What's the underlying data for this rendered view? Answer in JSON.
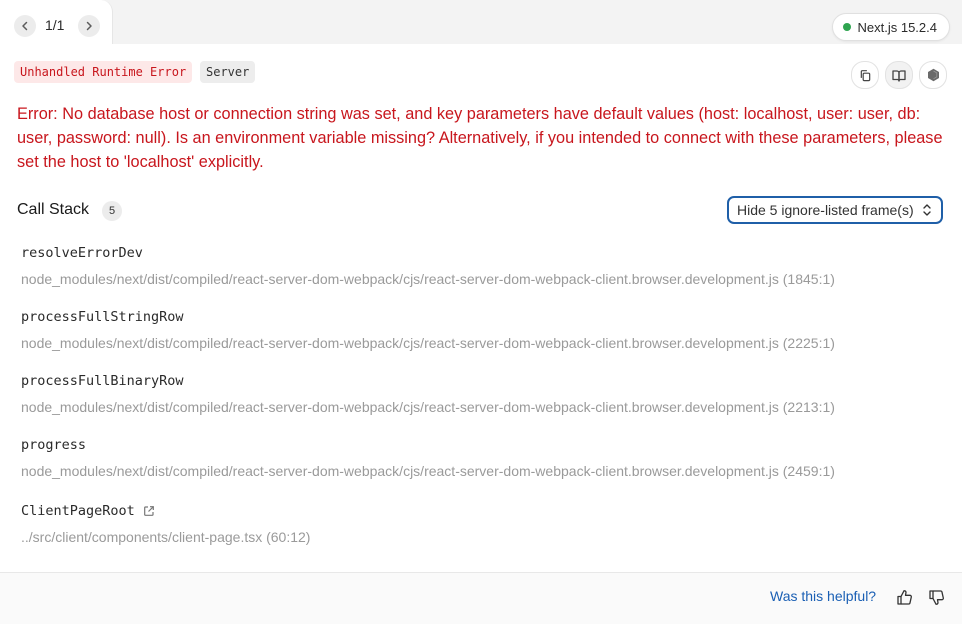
{
  "nav": {
    "count": "1/1",
    "prev_icon": "chevron-left-icon",
    "next_icon": "chevron-right-icon"
  },
  "version": {
    "label": "Next.js 15.2.4",
    "status_color": "#2ea44f"
  },
  "labels": {
    "error_type": "Unhandled Runtime Error",
    "environment": "Server"
  },
  "toolbar": {
    "copy_icon": "copy-icon",
    "docs_icon": "book-icon",
    "node_icon": "nodejs-icon"
  },
  "error": {
    "message": "Error: No database host or connection string was set, and key parameters have default values (host: localhost, user: user, db: user, password: null). Is an environment variable missing? Alternatively, if you intended to connect with these parameters, please set the host to 'localhost' explicitly.",
    "color": "#c8161d"
  },
  "call_stack": {
    "title": "Call Stack",
    "count": "5",
    "ignore_button": "Hide 5 ignore-listed frame(s)",
    "frames": [
      {
        "name": "resolveErrorDev",
        "file": "node_modules/next/dist/compiled/react-server-dom-webpack/cjs/react-server-dom-webpack-client.browser.development.js (1845:1)"
      },
      {
        "name": "processFullStringRow",
        "file": "node_modules/next/dist/compiled/react-server-dom-webpack/cjs/react-server-dom-webpack-client.browser.development.js (2225:1)"
      },
      {
        "name": "processFullBinaryRow",
        "file": "node_modules/next/dist/compiled/react-server-dom-webpack/cjs/react-server-dom-webpack-client.browser.development.js (2213:1)"
      },
      {
        "name": "progress",
        "file": "node_modules/next/dist/compiled/react-server-dom-webpack/cjs/react-server-dom-webpack-client.browser.development.js (2459:1)"
      },
      {
        "name": "ClientPageRoot",
        "file": "../src/client/components/client-page.tsx (60:12)"
      }
    ]
  },
  "footer": {
    "helpful_text": "Was this helpful?",
    "link_color": "#1a5fb4"
  }
}
